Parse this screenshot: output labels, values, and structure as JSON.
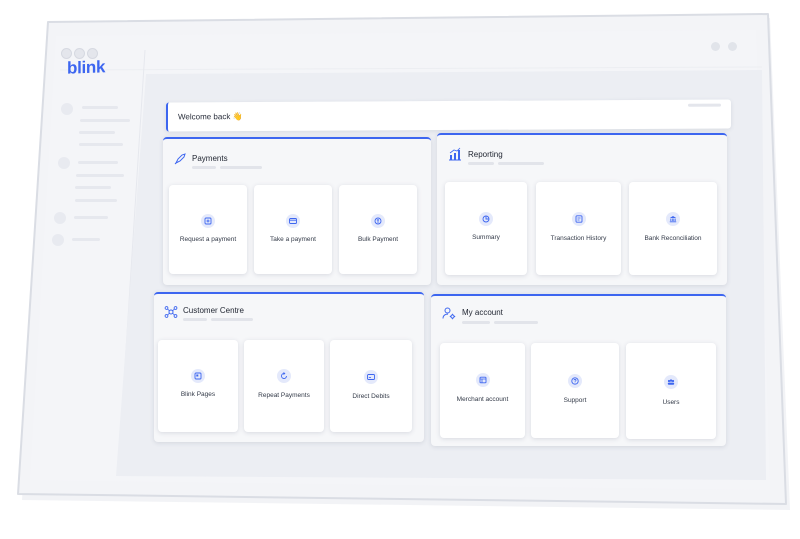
{
  "app": {
    "logo_text": "blink",
    "accent_color": "#3d66f0"
  },
  "welcome": {
    "text": "Welcome back 👋"
  },
  "panels": [
    {
      "title": "Payments",
      "icon": "rocket-icon",
      "cards": [
        {
          "label": "Request a payment",
          "icon": "request-payment-icon"
        },
        {
          "label": "Take a payment",
          "icon": "card-icon"
        },
        {
          "label": "Bulk Payment",
          "icon": "bulk-payment-icon"
        }
      ]
    },
    {
      "title": "Reporting",
      "icon": "chart-icon",
      "cards": [
        {
          "label": "Summary",
          "icon": "pie-chart-icon"
        },
        {
          "label": "Transaction History",
          "icon": "history-icon"
        },
        {
          "label": "Bank Reconciliation",
          "icon": "bank-icon"
        }
      ]
    },
    {
      "title": "Customer Centre",
      "icon": "network-icon",
      "cards": [
        {
          "label": "Blink Pages",
          "icon": "page-icon"
        },
        {
          "label": "Repeat Payments",
          "icon": "repeat-icon"
        },
        {
          "label": "Direct Debits",
          "icon": "direct-debit-icon"
        }
      ]
    },
    {
      "title": "My account",
      "icon": "user-settings-icon",
      "cards": [
        {
          "label": "Merchant account",
          "icon": "merchant-icon"
        },
        {
          "label": "Support",
          "icon": "help-icon"
        },
        {
          "label": "Users",
          "icon": "users-icon"
        }
      ]
    }
  ]
}
